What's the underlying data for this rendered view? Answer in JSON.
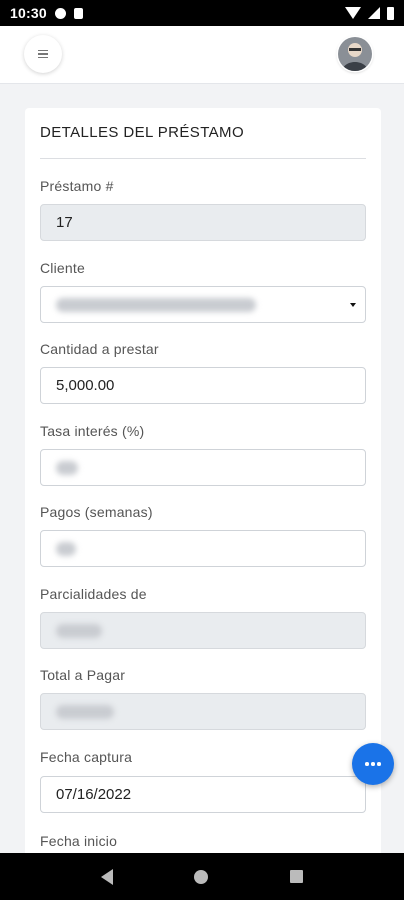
{
  "status_bar": {
    "time": "10:30"
  },
  "card": {
    "title": "DETALLES DEL PRÉSTAMO"
  },
  "fields": {
    "prestamo": {
      "label": "Préstamo #",
      "value": "17"
    },
    "cliente": {
      "label": "Cliente"
    },
    "cantidad": {
      "label": "Cantidad a prestar",
      "value": "5,000.00"
    },
    "tasa": {
      "label": "Tasa interés (%)"
    },
    "pagos": {
      "label": "Pagos (semanas)"
    },
    "parcialidades": {
      "label": "Parcialidades de"
    },
    "total": {
      "label": "Total a Pagar"
    },
    "fecha_captura": {
      "label": "Fecha captura",
      "value": "07/16/2022"
    },
    "fecha_inicio": {
      "label": "Fecha inicio"
    }
  },
  "colors": {
    "fab": "#1a73e8",
    "readonly_field": "#e9ecef"
  },
  "icons": [
    "menu-icon",
    "avatar",
    "more-horizontal-icon",
    "back-icon",
    "home-icon",
    "recents-icon"
  ]
}
